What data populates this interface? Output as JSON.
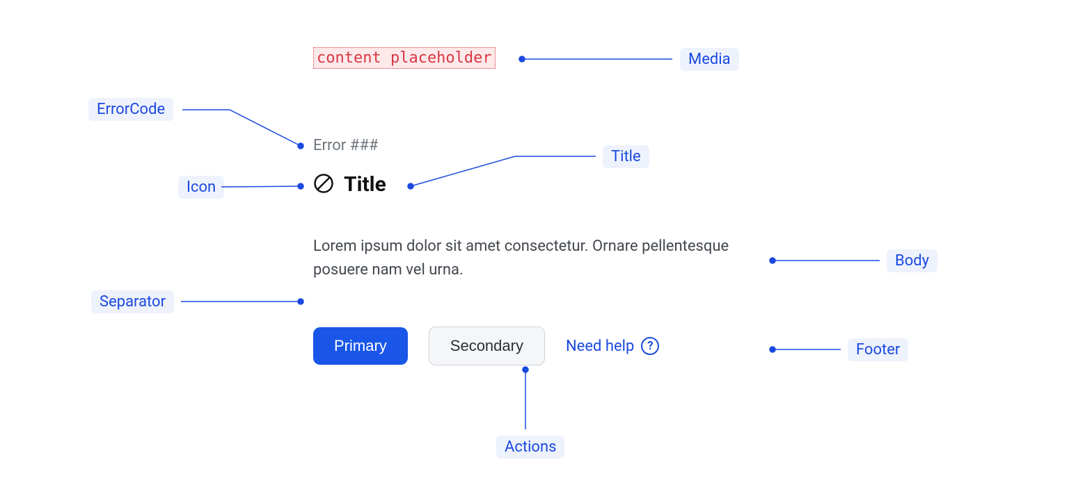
{
  "annotations": {
    "media": "Media",
    "errorCode": "ErrorCode",
    "icon": "Icon",
    "title": "Title",
    "body": "Body",
    "separator": "Separator",
    "actions": "Actions",
    "footer": "Footer"
  },
  "component": {
    "media_placeholder": "content placeholder",
    "error_code": "Error ###",
    "title": "Title",
    "body": "Lorem ipsum dolor sit amet consectetur. Ornare pellentesque posuere nam vel urna.",
    "primary_button": "Primary",
    "secondary_button": "Secondary",
    "footer_link": "Need help",
    "help_glyph": "?"
  }
}
